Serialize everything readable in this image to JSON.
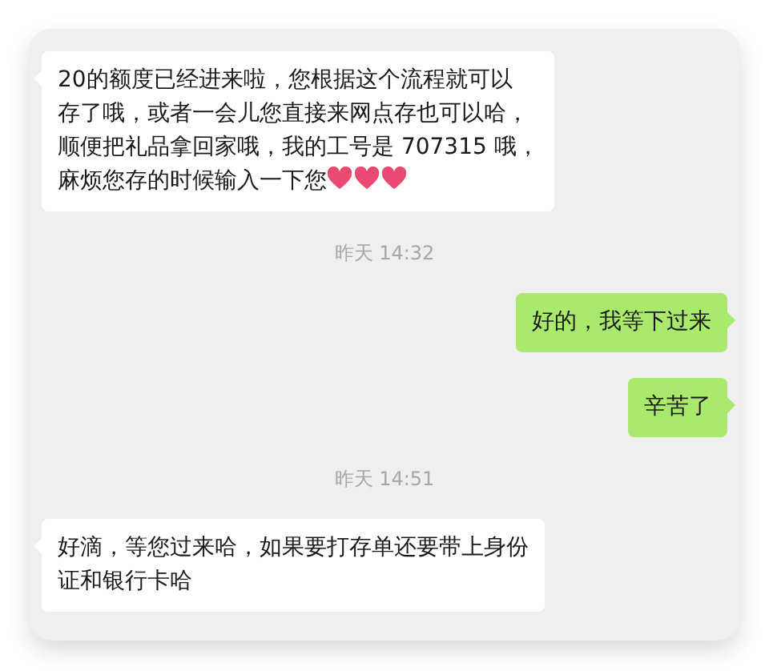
{
  "messages": [
    {
      "kind": "incoming",
      "lines": [
        "20的额度已经进来啦，您根据这个流程就可以",
        "存了哦，或者一会儿您直接来网点存也可以哈，",
        "顺便把礼品拿回家哦，我的工号是 707315 哦，",
        "麻烦您存的时候输入一下您"
      ],
      "hearts": true
    },
    {
      "kind": "time",
      "text": "昨天 14:32"
    },
    {
      "kind": "outgoing",
      "lines": [
        "好的，我等下过来"
      ]
    },
    {
      "kind": "outgoing",
      "lines": [
        "辛苦了"
      ]
    },
    {
      "kind": "time",
      "text": "昨天 14:51"
    },
    {
      "kind": "incoming",
      "lines": [
        "好滴，等您过来哈，如果要打存单还要带上身份",
        "证和银行卡哈"
      ]
    }
  ]
}
